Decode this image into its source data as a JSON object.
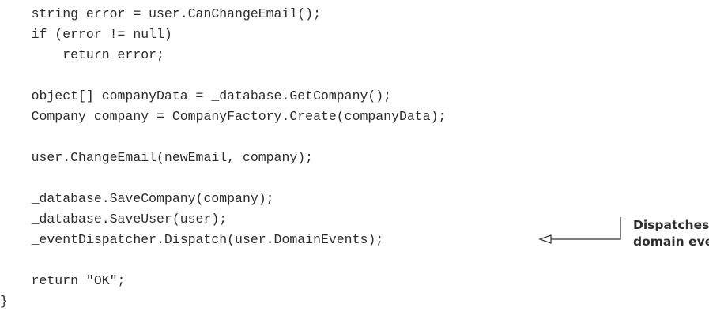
{
  "code": {
    "lines": [
      "    string error = user.CanChangeEmail();",
      "    if (error != null)",
      "        return error;",
      "",
      "    object[] companyData = _database.GetCompany();",
      "    Company company = CompanyFactory.Create(companyData);",
      "",
      "    user.ChangeEmail(newEmail, company);",
      "",
      "    _database.SaveCompany(company);",
      "    _database.SaveUser(user);",
      "    _eventDispatcher.Dispatch(user.DomainEvents);",
      "",
      "    return \"OK\";",
      "}"
    ]
  },
  "annotation": {
    "line1": "Dispatches user",
    "line2": "domain events"
  }
}
